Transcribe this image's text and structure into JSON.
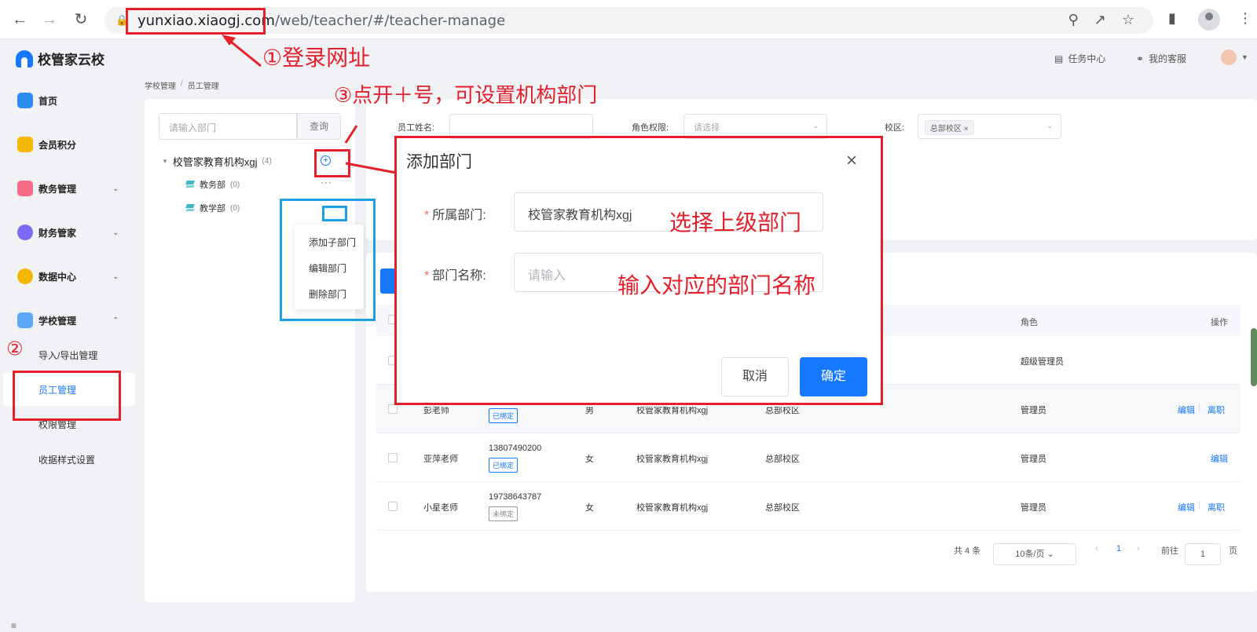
{
  "browser": {
    "url_host": "yunxiao.xiaogj.com",
    "url_path": "/web/teacher/#/teacher-manage"
  },
  "header": {
    "logo_text": "校管家云校",
    "task_center": "任务中心",
    "customer_service": "我的客服"
  },
  "sidebar": {
    "items": [
      {
        "label": "首页",
        "icon": "home-icon",
        "color": "#2d8cf0"
      },
      {
        "label": "会员积分",
        "icon": "crown-icon",
        "color": "#f5b800"
      },
      {
        "label": "教务管理",
        "icon": "calendar-icon",
        "color": "#f56c8a"
      },
      {
        "label": "财务管家",
        "icon": "wallet-icon",
        "color": "#7b6cf6"
      },
      {
        "label": "数据中心",
        "icon": "pie-chart-icon",
        "color": "#f5b800"
      },
      {
        "label": "学校管理",
        "icon": "school-icon",
        "color": "#5aa7f5"
      }
    ],
    "sub_items": [
      "导入/导出管理",
      "员工管理",
      "权限管理",
      "收据样式设置"
    ]
  },
  "breadcrumb": [
    "学校管理",
    "员工管理"
  ],
  "dept": {
    "search_placeholder": "请输入部门",
    "search_btn": "查询",
    "root": {
      "label": "校管家教育机构xgj",
      "count": "(4)"
    },
    "nodes": [
      {
        "label": "教务部",
        "count": "(0)"
      },
      {
        "label": "教学部",
        "count": "(0)"
      }
    ],
    "menu": [
      "添加子部门",
      "编辑部门",
      "删除部门"
    ]
  },
  "filters": {
    "name_label": "员工姓名:",
    "role_label": "角色权限:",
    "role_placeholder": "请选择",
    "campus_label": "校区:",
    "campus_tag": "总部校区"
  },
  "table": {
    "headers": {
      "role": "角色",
      "ops": "操作"
    },
    "rows": [
      {
        "name": "",
        "phone": "",
        "bind": "",
        "gender": "",
        "org": "",
        "campus": "",
        "role": "超级管理员",
        "edit": "",
        "leave": ""
      },
      {
        "name": "彭老师",
        "phone": "",
        "bind": "已绑定",
        "gender": "男",
        "org": "校管家教育机构xgj",
        "campus": "总部校区",
        "role": "管理员",
        "edit": "编辑",
        "leave": "离职"
      },
      {
        "name": "亚萍老师",
        "phone": "13807490200",
        "bind": "已绑定",
        "gender": "女",
        "org": "校管家教育机构xgj",
        "campus": "总部校区",
        "role": "管理员",
        "edit": "编辑",
        "leave": ""
      },
      {
        "name": "小星老师",
        "phone": "19738643787",
        "bind": "未绑定",
        "gender": "女",
        "org": "校管家教育机构xgj",
        "campus": "总部校区",
        "role": "管理员",
        "edit": "编辑",
        "leave": "离职"
      }
    ]
  },
  "pager": {
    "total": "共 4 条",
    "page_size": "10条/页",
    "current": "1",
    "goto_label": "前往",
    "goto_value": "1",
    "page_suffix": "页"
  },
  "modal": {
    "title": "添加部门",
    "parent_label": "所属部门:",
    "parent_value": "校管家教育机构xgj",
    "name_label": "部门名称:",
    "name_placeholder": "请输入",
    "cancel": "取消",
    "confirm": "确定"
  },
  "annotations": {
    "step1": "①登录网址",
    "step2": "②",
    "step3": "③点开＋号，可设置机构部门",
    "hint_parent": "选择上级部门",
    "hint_name": "输入对应的部门名称",
    "color_red": "#e5202a",
    "color_blue": "#1ea0e6"
  }
}
